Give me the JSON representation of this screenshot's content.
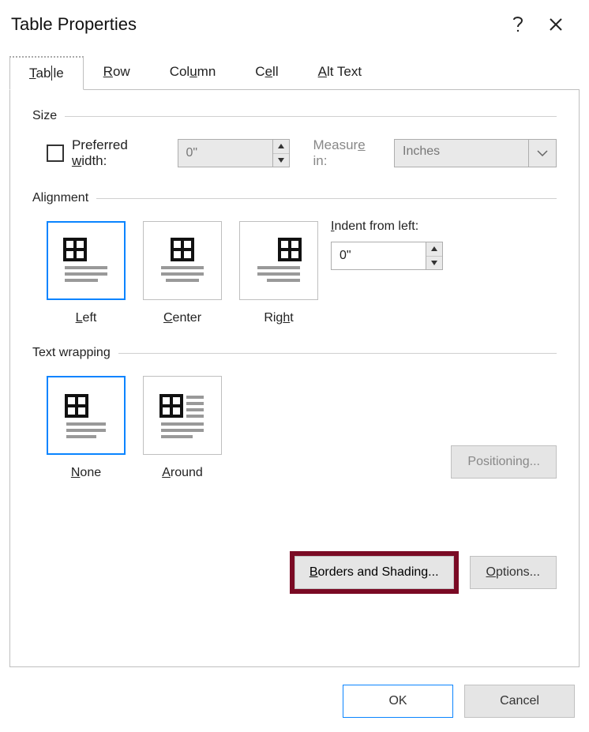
{
  "title": "Table Properties",
  "tabs": {
    "table": "Table",
    "row": "Row",
    "column": "Column",
    "cell": "Cell",
    "alttext": "Alt Text"
  },
  "size": {
    "heading": "Size",
    "preferred_width_label": "Preferred width:",
    "preferred_width_value": "0\"",
    "measure_label": "Measure in:",
    "measure_value": "Inches"
  },
  "alignment": {
    "heading": "Alignment",
    "left": "Left",
    "center": "Center",
    "right": "Right",
    "indent_label": "Indent from left:",
    "indent_value": "0\""
  },
  "wrapping": {
    "heading": "Text wrapping",
    "none": "None",
    "around": "Around",
    "positioning": "Positioning..."
  },
  "buttons": {
    "borders": "Borders and Shading...",
    "options": "Options...",
    "ok": "OK",
    "cancel": "Cancel"
  }
}
